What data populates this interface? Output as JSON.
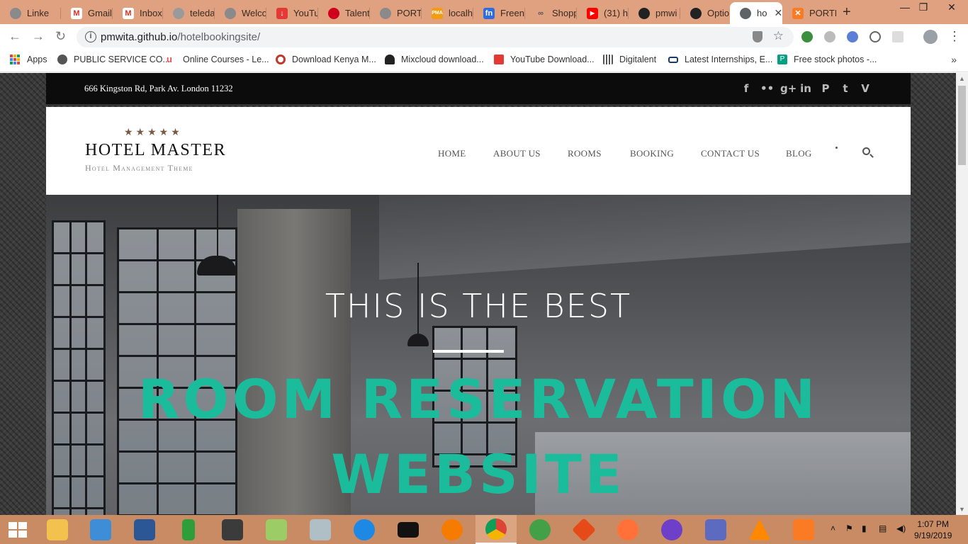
{
  "browser": {
    "tabs": [
      {
        "title": "Linke",
        "favicon": "globe-icon",
        "color": "#8a8a8a"
      },
      {
        "title": "Gmail",
        "favicon": "gmail-icon",
        "color": "#d93025"
      },
      {
        "title": "Inbox",
        "favicon": "gmail-icon",
        "color": "#d93025"
      },
      {
        "title": "teleda",
        "favicon": "globe-icon",
        "color": "#9a9a9a"
      },
      {
        "title": "Welco",
        "favicon": "globe-icon",
        "color": "#8a8a8a"
      },
      {
        "title": "YouTu",
        "favicon": "download-icon",
        "color": "#e53935"
      },
      {
        "title": "Talent",
        "favicon": "huawei-icon",
        "color": "#d0021b"
      },
      {
        "title": "PORTF",
        "favicon": "globe-icon",
        "color": "#8a8a8a"
      },
      {
        "title": "localh",
        "favicon": "phpmyadmin-icon",
        "color": "#f39c12"
      },
      {
        "title": "Freenc",
        "favicon": "freenom-icon",
        "color": "#2d6cdf"
      },
      {
        "title": "Shopp",
        "favicon": "link-icon",
        "color": "#666666"
      },
      {
        "title": "(31) h",
        "favicon": "youtube-icon",
        "color": "#ff0000"
      },
      {
        "title": "pmwi",
        "favicon": "github-icon",
        "color": "#222222"
      },
      {
        "title": "Option",
        "favicon": "github-icon",
        "color": "#222222"
      },
      {
        "title": "ho",
        "favicon": "globe-icon",
        "color": "#5f6368",
        "active": true
      },
      {
        "title": "PORTF",
        "favicon": "xampp-icon",
        "color": "#fb7a24"
      }
    ],
    "url_host": "pmwita.github.io",
    "url_path": "/hotelbookingsite/",
    "bookmarks": [
      {
        "label": "Apps",
        "icon": "apps-grid-icon",
        "color": "#d44"
      },
      {
        "label": "PUBLIC SERVICE CO...",
        "icon": "globe-icon",
        "color": "#555"
      },
      {
        "label": "Online Courses - Le...",
        "icon": "udemy-icon",
        "color": "#ec5252"
      },
      {
        "label": "Download Kenya M...",
        "icon": "target-icon",
        "color": "#c0392b"
      },
      {
        "label": "Mixcloud download...",
        "icon": "cloud-icon",
        "color": "#222"
      },
      {
        "label": "YouTube Download...",
        "icon": "download-icon",
        "color": "#e53935"
      },
      {
        "label": "Digitalent",
        "icon": "digitalent-icon",
        "color": "#555"
      },
      {
        "label": "Latest Internships, E...",
        "icon": "card-icon",
        "color": "#1a3a6b"
      },
      {
        "label": "Free stock photos -...",
        "icon": "pexels-icon",
        "color": "#05a081"
      }
    ]
  },
  "site": {
    "address": "666 Kingston Rd, Park Av. London 11232",
    "social": [
      "f",
      "••",
      "g+",
      "in",
      "P",
      "t",
      "V"
    ],
    "logo_stars": "★★★★★",
    "logo_name": "HOTEL MASTER",
    "logo_tagline": "Hotel Management Theme",
    "nav": [
      "HOME",
      "ABOUT US",
      "ROOMS",
      "BOOKING",
      "CONTACT US",
      "BLOG"
    ],
    "hero_small": "THIS IS THE BEST",
    "hero_line1": "ROOM RESERVATION",
    "hero_line2": "WEBSITE",
    "accent": "#1abc9c"
  },
  "taskbar": {
    "apps": [
      "file-explorer-icon",
      "control-panel-icon",
      "word-icon",
      "pipe-icon",
      "sublime-icon",
      "notepad-icon",
      "task-manager-icon",
      "sync-icon",
      "cmd-icon",
      "uc-browser-icon",
      "chrome-icon",
      "idm-icon",
      "git-icon",
      "firefox-icon",
      "github-desktop-icon",
      "virtualbox-icon",
      "vlc-icon",
      "xampp-icon"
    ],
    "time": "1:07 PM",
    "date": "9/19/2019"
  }
}
